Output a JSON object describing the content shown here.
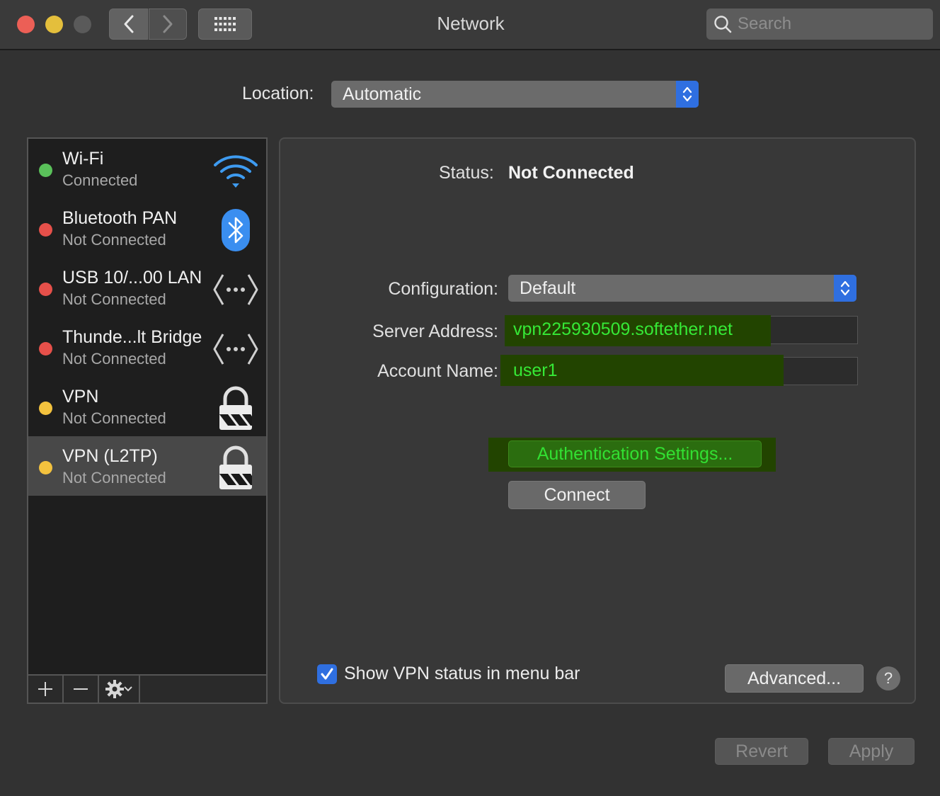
{
  "window": {
    "title": "Network"
  },
  "search": {
    "placeholder": "Search"
  },
  "location": {
    "label": "Location:",
    "value": "Automatic"
  },
  "services": [
    {
      "name": "Wi-Fi",
      "status": "Connected",
      "dot_color": "#5ac15a",
      "icon": "wifi-icon"
    },
    {
      "name": "Bluetooth PAN",
      "status": "Not Connected",
      "dot_color": "#e6504a",
      "icon": "bluetooth-icon"
    },
    {
      "name": "USB 10/...00 LAN",
      "status": "Not Connected",
      "dot_color": "#e6504a",
      "icon": "ethernet-icon"
    },
    {
      "name": "Thunde...lt Bridge",
      "status": "Not Connected",
      "dot_color": "#e6504a",
      "icon": "ethernet-icon"
    },
    {
      "name": "VPN",
      "status": "Not Connected",
      "dot_color": "#f3c23e",
      "icon": "vpn-lock-icon"
    },
    {
      "name": "VPN (L2TP)",
      "status": "Not Connected",
      "dot_color": "#f3c23e",
      "icon": "vpn-lock-icon",
      "selected": true
    }
  ],
  "list_controls": {
    "add": "+",
    "remove": "—"
  },
  "detail": {
    "status_label": "Status:",
    "status_value": "Not Connected",
    "configuration_label": "Configuration:",
    "configuration_value": "Default",
    "server_label": "Server Address:",
    "server_value": "vpn225930509.softether.net",
    "account_label": "Account Name:",
    "account_value": "user1",
    "auth_button": "Authentication Settings...",
    "connect_button": "Connect",
    "show_vpn_label": "Show VPN status in menu bar",
    "show_vpn_checked": true,
    "advanced_button": "Advanced...",
    "help_button": "?"
  },
  "footer": {
    "revert": "Revert",
    "apply": "Apply"
  },
  "colors": {
    "accent": "#2f6fe0",
    "highlight_text": "#36e936",
    "highlight_bg": "#224400"
  }
}
